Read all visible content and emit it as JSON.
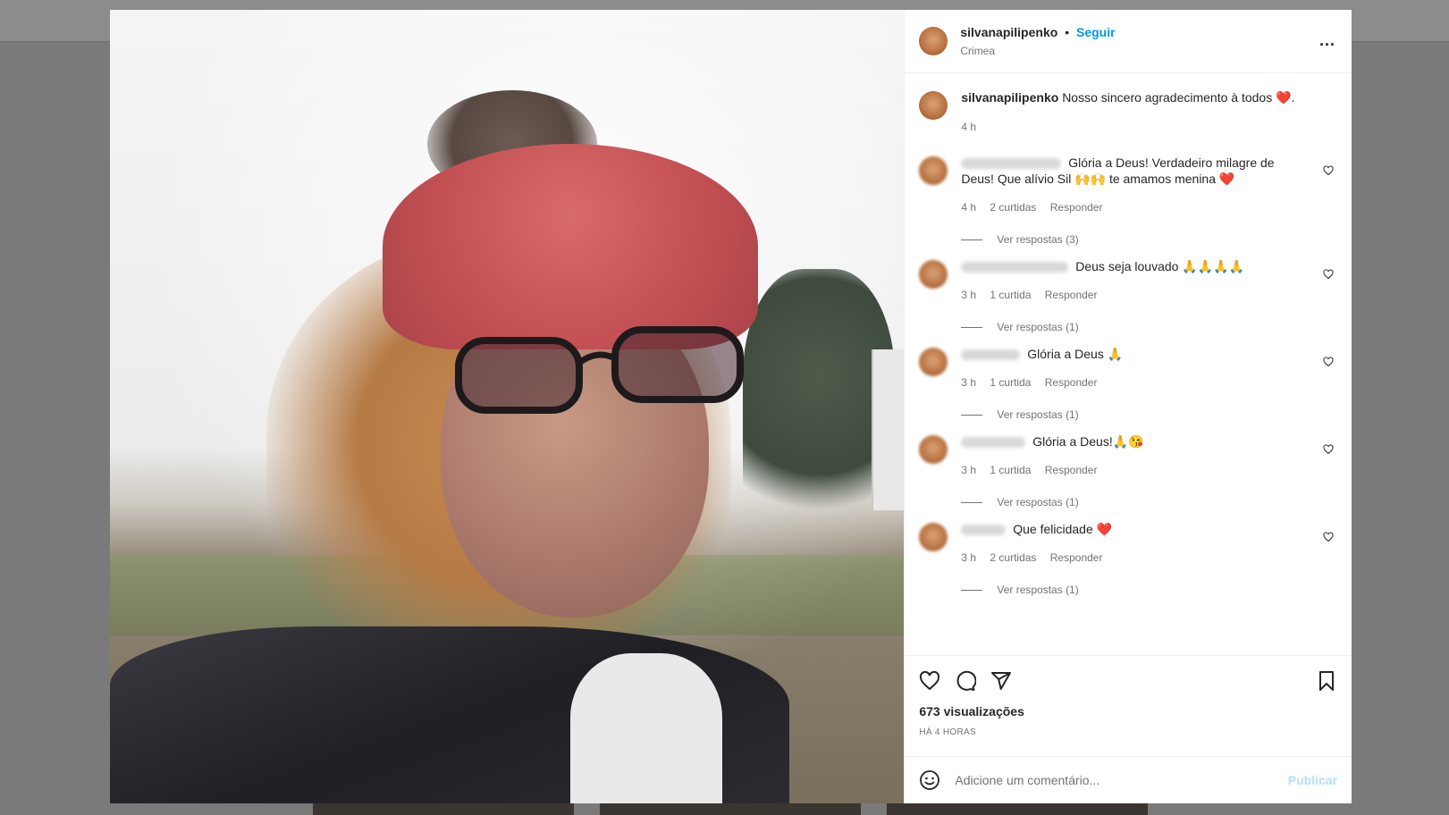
{
  "post": {
    "username": "silvanapilipenko",
    "follow_label": "Seguir",
    "location": "Crimea",
    "dot": "•",
    "more": "..."
  },
  "caption": {
    "username": "silvanapilipenko",
    "text": "Nosso sincero agradecimento à todos",
    "emoji": "❤️",
    "suffix": ".",
    "time": "4 h"
  },
  "comments": [
    {
      "text": "Glória a Deus! Verdadeiro milagre de Deus! Que alívio Sil 🙌🙌 te amamos menina ❤️",
      "time": "4 h",
      "likes": "2 curtidas",
      "reply": "Responder",
      "view_replies": "Ver respostas (3)"
    },
    {
      "text": "Deus seja louvado 🙏🙏🙏🙏",
      "time": "3 h",
      "likes": "1 curtida",
      "reply": "Responder",
      "view_replies": "Ver respostas (1)"
    },
    {
      "text": "Glória a Deus 🙏",
      "time": "3 h",
      "likes": "1 curtida",
      "reply": "Responder",
      "view_replies": "Ver respostas (1)"
    },
    {
      "text": "Glória a Deus!🙏😘",
      "time": "3 h",
      "likes": "1 curtida",
      "reply": "Responder",
      "view_replies": "Ver respostas (1)"
    },
    {
      "text": "Que felicidade ❤️",
      "time": "3 h",
      "likes": "2 curtidas",
      "reply": "Responder",
      "view_replies": "Ver respostas (1)"
    }
  ],
  "actions": {
    "views": "673 visualizações",
    "time_ago": "HÁ 4 HORAS",
    "icons": [
      "heart-icon",
      "comment-icon",
      "share-icon",
      "bookmark-icon"
    ]
  },
  "add_comment": {
    "placeholder": "Adicione um comentário...",
    "publish_label": "Publicar",
    "emoji_icon": "smiley-icon"
  },
  "colors": {
    "link_blue": "#0095f6",
    "publish_disabled": "#b2dffc",
    "secondary_text": "#737373"
  }
}
